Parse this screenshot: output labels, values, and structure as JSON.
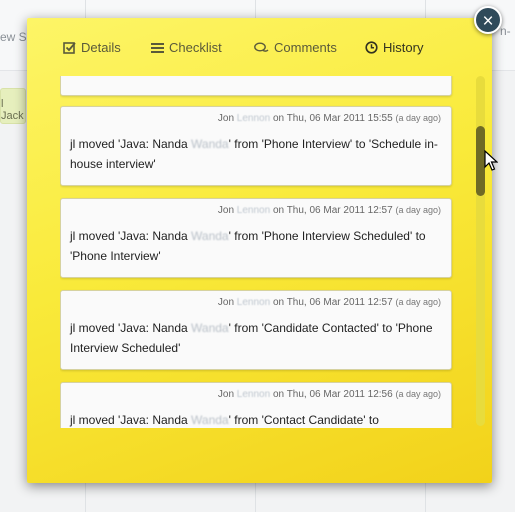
{
  "background": {
    "header_fragment_left": "ew Sc",
    "header_fragment_right": "n-",
    "card_fragment": "l Jack"
  },
  "modal": {
    "close_symbol": "×",
    "tabs": [
      {
        "label": "Details",
        "icon": "checkbox-icon"
      },
      {
        "label": "Checklist",
        "icon": "list-icon"
      },
      {
        "label": "Comments",
        "icon": "chat-icon"
      },
      {
        "label": "History",
        "icon": "clock-icon",
        "active": true
      }
    ],
    "history": [
      {
        "author_first": "Jon",
        "author_last": "Lennon",
        "on": "on",
        "timestamp": "Thu, 06 Mar 2011 15:55",
        "ago": "(a day ago)",
        "prefix": "jl moved 'Java: Nanda",
        "redacted": "Wanda",
        "suffix": "' from 'Phone Interview' to 'Schedule in-house interview'"
      },
      {
        "author_first": "Jon",
        "author_last": "Lennon",
        "on": "on",
        "timestamp": "Thu, 06 Mar 2011 12:57",
        "ago": "(a day ago)",
        "prefix": "jl moved 'Java: Nanda",
        "redacted": "Wanda",
        "suffix": "' from 'Phone Interview Scheduled' to 'Phone Interview'"
      },
      {
        "author_first": "Jon",
        "author_last": "Lennon",
        "on": "on",
        "timestamp": "Thu, 06 Mar 2011 12:57",
        "ago": "(a day ago)",
        "prefix": "jl moved 'Java: Nanda",
        "redacted": "Wanda",
        "suffix": "' from 'Candidate Contacted' to 'Phone Interview Scheduled'"
      },
      {
        "author_first": "Jon",
        "author_last": "Lennon",
        "on": "on",
        "timestamp": "Thu, 06 Mar 2011 12:56",
        "ago": "(a day ago)",
        "prefix": "jl moved 'Java: Nanda",
        "redacted": "Wanda",
        "suffix": "' from 'Contact Candidate' to"
      }
    ]
  }
}
